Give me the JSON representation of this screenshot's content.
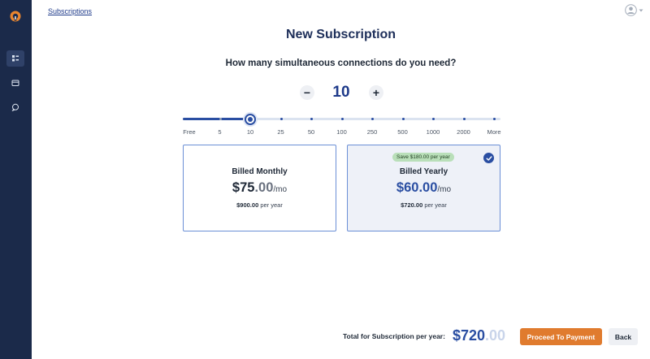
{
  "sidebar": {
    "logo_icon": "app-logo-icon",
    "items": [
      {
        "name": "dashboard",
        "icon": "dashboard-icon",
        "active": true
      },
      {
        "name": "billing",
        "icon": "card-icon",
        "active": false
      },
      {
        "name": "support",
        "icon": "chat-icon",
        "active": false
      }
    ],
    "colors": {
      "background": "#1b2a4a",
      "active": "#2f4168",
      "logo": "#e9852f"
    }
  },
  "breadcrumb": {
    "label": "Subscriptions"
  },
  "user_menu": {
    "icon": "user-avatar-icon",
    "chevron": "chevron-down-icon"
  },
  "page": {
    "title": "New Subscription",
    "question": "How many simultaneous connections do you need?"
  },
  "stepper": {
    "minus_label": "−",
    "plus_label": "+",
    "value": "10"
  },
  "slider": {
    "ticks": [
      "Free",
      "5",
      "10",
      "25",
      "50",
      "100",
      "250",
      "500",
      "1000",
      "2000",
      "More"
    ],
    "selected_index": 2,
    "selected_label": "10"
  },
  "plans": {
    "monthly": {
      "title": "Billed Monthly",
      "price_whole": "$75",
      "price_cents": ".00",
      "per": "/mo",
      "year_amount": "$900.00",
      "year_suffix": " per year",
      "selected": false
    },
    "yearly": {
      "badge": "Save $180.00 per year",
      "title": "Billed Yearly",
      "price_whole": "$60",
      "price_cents": ".00",
      "per": "/mo",
      "year_amount": "$720.00",
      "year_suffix": " per year",
      "selected": true,
      "check_icon": "check-circle-icon"
    }
  },
  "footer": {
    "total_label": "Total for Subscription per year:",
    "total_whole": "$720",
    "total_cents": ".00",
    "proceed_label": "Proceed To Payment",
    "back_label": "Back"
  },
  "colors": {
    "accent": "#2a4ea2",
    "title": "#1e2f5a",
    "proceed": "#e07b2e",
    "badge": "#b9dfb9",
    "card_border": "#6b8fd6"
  }
}
